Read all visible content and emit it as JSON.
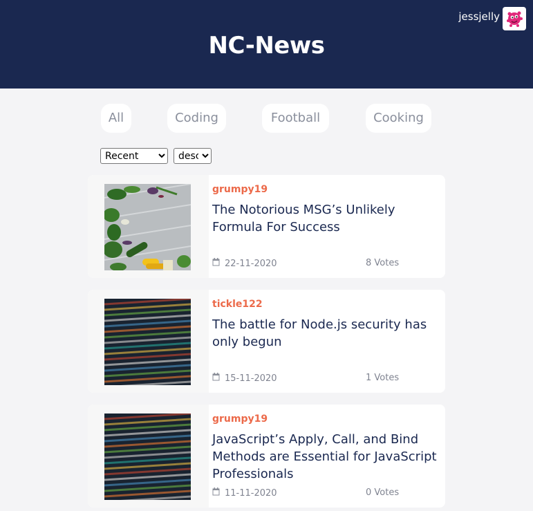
{
  "header": {
    "site_title": "NC-News",
    "username": "jessjelly",
    "avatar_icon": "pink-creature-avatar-icon"
  },
  "topics": [
    "All",
    "Coding",
    "Football",
    "Cooking"
  ],
  "controls": {
    "sort_by": "Recent",
    "order": "desc"
  },
  "articles": [
    {
      "author": "grumpy19",
      "title": "The Notorious MSG’s Unlikely Formula For Success",
      "date": "22-11-2020",
      "votes": "8 Votes",
      "image": "vegetables-on-table-image"
    },
    {
      "author": "tickle122",
      "title": "The battle for Node.js security has only begun",
      "date": "15-11-2020",
      "votes": "1 Votes",
      "image": "code-screen-image"
    },
    {
      "author": "grumpy19",
      "title": "JavaScript’s Apply, Call, and Bind Methods are Essential for JavaScript Professionals",
      "date": "11-11-2020",
      "votes": "0 Votes",
      "image": "code-screen-image"
    }
  ],
  "colors": {
    "header_bg": "#1a2850",
    "author": "#ec6a4a",
    "title": "#1a2850",
    "meta": "#7f8390"
  }
}
